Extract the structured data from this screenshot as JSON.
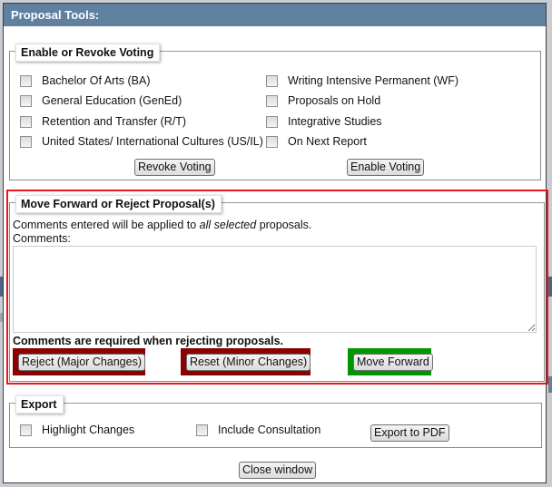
{
  "dialog": {
    "title": "Proposal Tools:"
  },
  "voting": {
    "legend": "Enable or Revoke Voting",
    "left_options": [
      {
        "label": "Bachelor Of Arts (BA)",
        "checked": false
      },
      {
        "label": "General Education (GenEd)",
        "checked": false
      },
      {
        "label": "Retention and Transfer (R/T)",
        "checked": false
      },
      {
        "label": "United States/ International Cultures (US/IL)",
        "checked": false
      }
    ],
    "right_options": [
      {
        "label": "Writing Intensive Permanent (WF)",
        "checked": false
      },
      {
        "label": "Proposals on Hold",
        "checked": false
      },
      {
        "label": "Integrative Studies",
        "checked": false
      },
      {
        "label": "On Next Report",
        "checked": false
      }
    ],
    "revoke_label": "Revoke Voting",
    "enable_label": "Enable Voting"
  },
  "move": {
    "legend": "Move Forward or Reject Proposal(s)",
    "info_prefix": "Comments entered will be applied to ",
    "info_emphasis": "all selected",
    "info_suffix": " proposals.",
    "comments_label": "Comments:",
    "comments_value": "",
    "required_note": "Comments are required when rejecting proposals.",
    "reject_label": "Reject (Major Changes)",
    "reset_label": "Reset (Minor Changes)",
    "forward_label": "Move Forward",
    "colors": {
      "highlight_border": "#e8171d",
      "reject_frame": "#8b0000",
      "reset_frame": "#8b0000",
      "forward_frame": "#009600"
    }
  },
  "export": {
    "legend": "Export",
    "highlight_label": "Highlight Changes",
    "highlight_checked": false,
    "consultation_label": "Include Consultation",
    "consultation_checked": false,
    "pdf_label": "Export to PDF"
  },
  "close_label": "Close window"
}
